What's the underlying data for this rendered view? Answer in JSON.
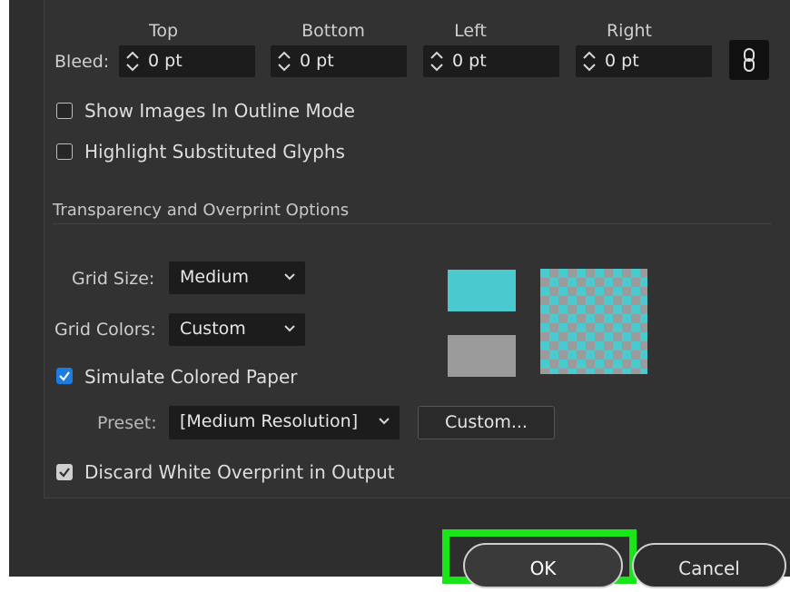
{
  "bleed": {
    "label": "Bleed:",
    "columns": [
      {
        "header": "Top",
        "value": "0 pt"
      },
      {
        "header": "Bottom",
        "value": "0 pt"
      },
      {
        "header": "Left",
        "value": "0 pt"
      },
      {
        "header": "Right",
        "value": "0 pt"
      }
    ],
    "link_icon": "chain-link-icon"
  },
  "options": {
    "show_images_outline": {
      "label": "Show Images In Outline Mode",
      "checked": false
    },
    "highlight_glyphs": {
      "label": "Highlight Substituted Glyphs",
      "checked": false
    }
  },
  "transparency": {
    "section_title": "Transparency and Overprint Options",
    "grid_size": {
      "label": "Grid Size:",
      "value": "Medium"
    },
    "grid_colors": {
      "label": "Grid Colors:",
      "value": "Custom"
    },
    "simulate_paper": {
      "label": "Simulate Colored Paper",
      "checked": true
    },
    "preset": {
      "label": "Preset:",
      "value": "[Medium Resolution]"
    },
    "custom_button": "Custom...",
    "discard_white": {
      "label": "Discard White Overprint in Output",
      "checked": true
    },
    "colors": {
      "grid_color_1": "#4ac9cf",
      "grid_color_2": "#9b9b9b"
    }
  },
  "footer": {
    "ok": "OK",
    "cancel": "Cancel",
    "highlight_color": "#19e619"
  }
}
